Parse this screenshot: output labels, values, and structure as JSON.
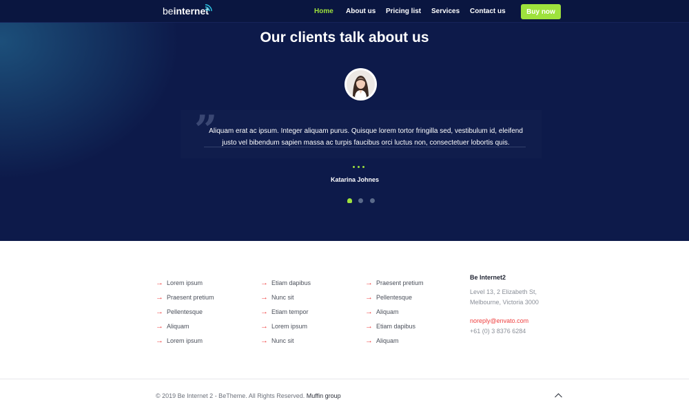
{
  "header": {
    "logo_part1": "be",
    "logo_part2": "internet",
    "nav": [
      "Home",
      "About us",
      "Pricing list",
      "Services",
      "Contact us"
    ],
    "active_nav": "Home",
    "cta_label": "Buy now"
  },
  "testimonial": {
    "title": "Our clients talk about us",
    "quote": "Aliquam erat ac ipsum. Integer aliquam purus. Quisque lorem tortor fringilla sed, vestibulum id, eleifend justo vel bibendum sapien massa ac turpis faucibus orci luctus non, consectetuer lobortis quis.",
    "author": "Katarina Johnes",
    "pages": 3,
    "active_page": 1
  },
  "footer": {
    "columns": [
      [
        "Lorem ipsum",
        "Praesent pretium",
        "Pellentesque",
        "Aliquam",
        "Lorem ipsum"
      ],
      [
        "Etiam dapibus",
        "Nunc sit",
        "Etiam tempor",
        "Lorem ipsum",
        "Nunc sit"
      ],
      [
        "Praesent pretium",
        "Pellentesque",
        "Aliquam",
        "Etiam dapibus",
        "Aliquam"
      ]
    ],
    "contact": {
      "company": "Be Internet2",
      "address_line1": "Level 13, 2 Elizabeth St,",
      "address_line2": "Melbourne, Victoria 3000",
      "email": "noreply@envato.com",
      "phone": "+61 (0) 3 8376 6284"
    },
    "copyright": "© 2019 Be Internet 2 - BeTheme. All Rights Reserved.",
    "copyright_brand": "Muffin group"
  },
  "colors": {
    "accent_green": "#9ee23d",
    "hero_bg": "#0d1a4a",
    "link_arrow_red": "#ef3e3e"
  },
  "icons": {
    "logo_wifi": "wifi-icon",
    "link_arrow": "arrow-right-icon",
    "back_to_top": "chevron-up-icon"
  }
}
